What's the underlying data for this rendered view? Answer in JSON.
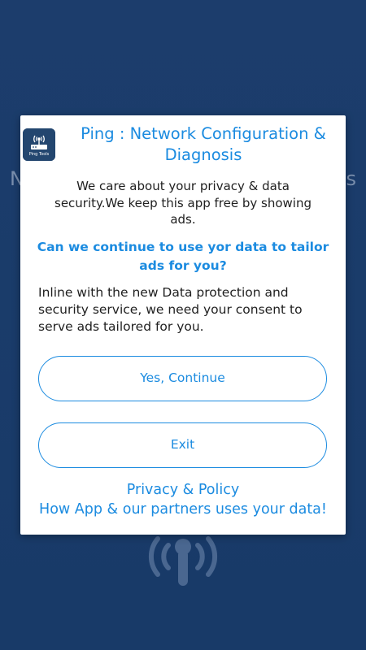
{
  "background": {
    "left_text": "N",
    "right_text": "s",
    "color": "#1c3d6c"
  },
  "dialog": {
    "app_icon": {
      "label": "Ping Tools",
      "icon": "router-signal-icon"
    },
    "title": "Ping : Network Configuration & Diagnosis",
    "privacy_text": "We care about your privacy & data security.We keep this app free by showing ads.",
    "question": "Can we continue to use yor data to tailor ads for you?",
    "consent_text": "Inline with the new Data protection and security service, we need your consent to serve ads tailored for you.",
    "buttons": {
      "continue_label": "Yes, Continue",
      "exit_label": "Exit"
    },
    "links": {
      "privacy_policy": "Privacy & Policy",
      "partners_data": "How App & our partners uses your data!"
    }
  },
  "colors": {
    "accent": "#1b8be0",
    "text": "#1f1f1f",
    "dialog_bg": "#ffffff"
  }
}
